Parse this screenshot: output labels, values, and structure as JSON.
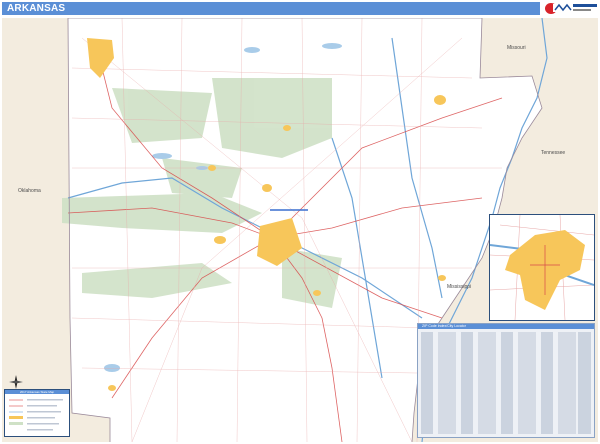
{
  "header": {
    "title": "ARKANSAS",
    "logo_icon": "market-maps-logo"
  },
  "map": {
    "neighbor_labels": {
      "missouri": "Missouri",
      "oklahoma": "Oklahoma",
      "tennessee": "Tennessee",
      "mississippi": "Mississippi"
    },
    "colors": {
      "land_state": "#ffffff",
      "land_neighbor": "#f3ecdf",
      "urban": "#f7c65a",
      "forest": "#cfe1c6",
      "water": "#a9cce9",
      "river": "#6fa6d8",
      "road_major": "#d84a4a",
      "road_minor": "#e7a7a7",
      "border": "#2c4f7c",
      "accent": "#5b8fd6"
    }
  },
  "inset": {
    "name": "little-rock-metro-inset"
  },
  "index": {
    "title": "ZIP Code Index/City Locator"
  },
  "legend": {
    "title": "2017 Arkansas State Map"
  },
  "icons": {
    "compass": "compass-rose-icon"
  }
}
